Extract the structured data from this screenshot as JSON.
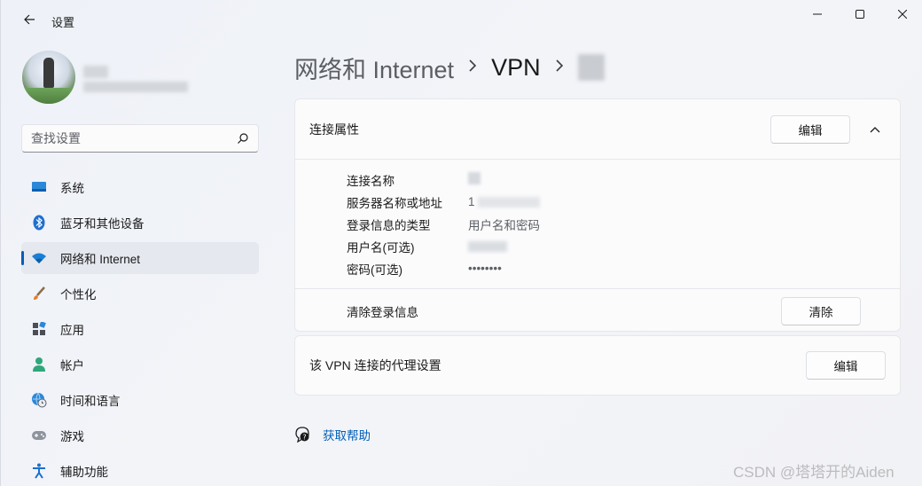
{
  "window": {
    "title": "设置",
    "controls": [
      "minimize",
      "maximize",
      "close"
    ]
  },
  "profile": {
    "avatar_icon": "user-avatar"
  },
  "search": {
    "placeholder": "查找设置",
    "icon": "search-icon"
  },
  "sidebar": {
    "items": [
      {
        "label": "系统",
        "icon": "system-display-icon",
        "active": false
      },
      {
        "label": "蓝牙和其他设备",
        "icon": "bluetooth-icon",
        "active": false
      },
      {
        "label": "网络和 Internet",
        "icon": "wifi-network-icon",
        "active": true
      },
      {
        "label": "个性化",
        "icon": "paintbrush-icon",
        "active": false
      },
      {
        "label": "应用",
        "icon": "apps-icon",
        "active": false
      },
      {
        "label": "帐户",
        "icon": "account-person-icon",
        "active": false
      },
      {
        "label": "时间和语言",
        "icon": "globe-clock-icon",
        "active": false
      },
      {
        "label": "游戏",
        "icon": "gamepad-icon",
        "active": false
      },
      {
        "label": "辅助功能",
        "icon": "accessibility-icon",
        "active": false
      }
    ]
  },
  "breadcrumb": {
    "parent": "网络和 Internet",
    "middle": "VPN"
  },
  "connection_card": {
    "title": "连接属性",
    "edit_label": "编辑",
    "properties": [
      {
        "key": "连接名称",
        "value": ""
      },
      {
        "key": "服务器名称或地址",
        "value": "1"
      },
      {
        "key": "登录信息的类型",
        "value": "用户名和密码"
      },
      {
        "key": "用户名(可选)",
        "value": ""
      },
      {
        "key": "密码(可选)",
        "value": "••••••••"
      }
    ],
    "clear_label": "清除登录信息",
    "clear_button": "清除"
  },
  "proxy_card": {
    "title": "该 VPN 连接的代理设置",
    "edit_label": "编辑"
  },
  "help": {
    "label": "获取帮助"
  },
  "watermark": "CSDN @塔塔开的Aiden",
  "colors": {
    "accent": "#005fb8",
    "background": "#eef1f7",
    "card": "#fbfbfc"
  }
}
